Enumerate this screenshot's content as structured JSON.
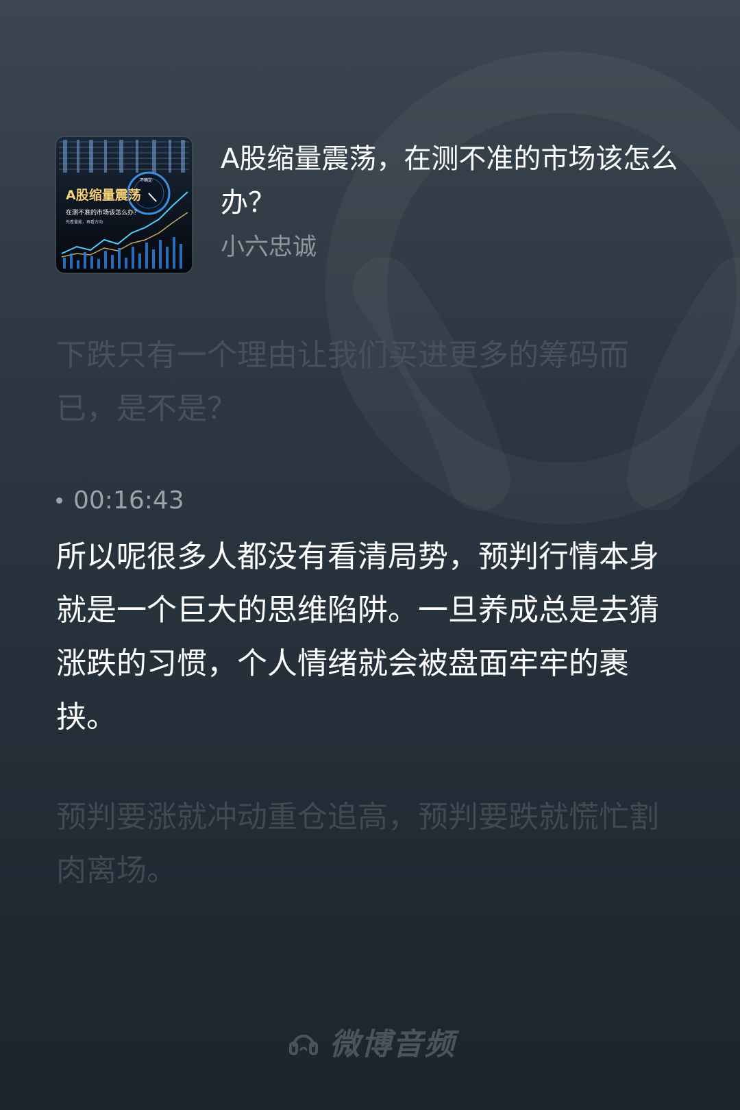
{
  "episode": {
    "cover": {
      "title": "A股缩量震荡",
      "subtitle": "在测不准的市场该怎么办？",
      "tagline": "先看量能，再看方向",
      "dial_label": "不确定"
    },
    "title": "A股缩量震荡，在测不准的市场该怎么办？",
    "author": "小六忠诚"
  },
  "transcript": {
    "previous_line": "下跌只有一个理由让我们买进更多的筹码而已，是不是？",
    "current_timestamp": "00:16:43",
    "current_line": "所以呢很多人都没有看清局势，预判行情本身就是一个巨大的思维陷阱。一旦养成总是去猜涨跌的习惯，个人情绪就会被盘面牢牢的裹挟。",
    "next_line": "预判要涨就冲动重仓追高，预判要跌就慌忙割肉离场。"
  },
  "brand": {
    "name": "微博音频",
    "icon": "weibo-audio-logo-icon"
  },
  "colors": {
    "background_top": "#3b4651",
    "background_bottom": "#1c242c",
    "text_current": "#ffffff",
    "text_dim": "#47515b",
    "author": "#8e969e",
    "cover_title": "#f3d27a"
  }
}
